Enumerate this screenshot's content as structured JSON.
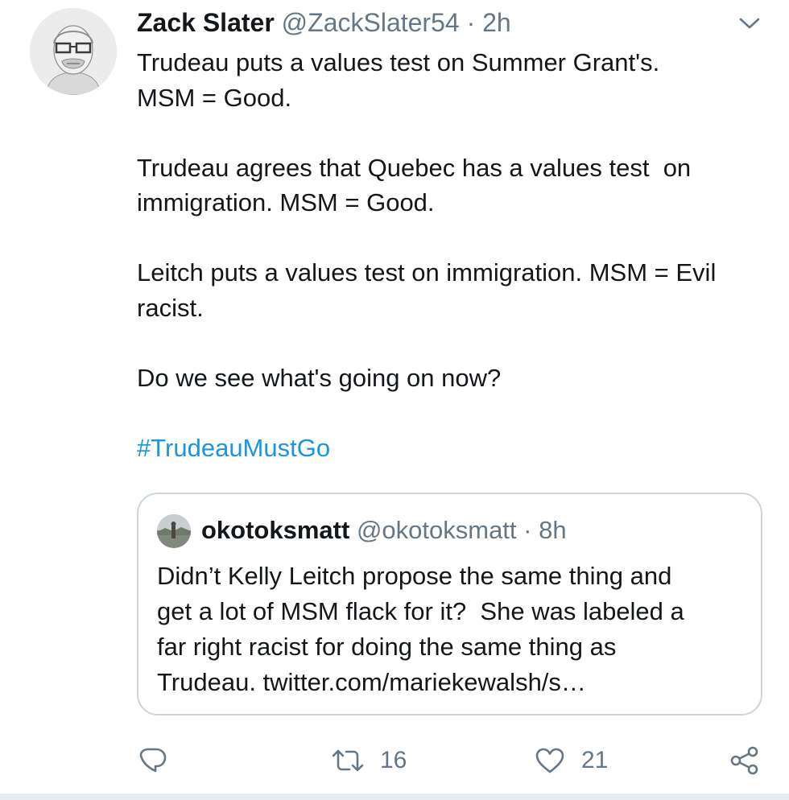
{
  "tweet": {
    "author_name": "Zack Slater",
    "author_handle": "@ZackSlater54",
    "separator": "·",
    "time": "2h",
    "paragraphs": [
      [
        "Trudeau puts a values test on Summer Grant's.",
        "MSM = Good."
      ],
      [
        "Trudeau agrees that Quebec has a values test  on",
        "immigration. MSM = Good."
      ],
      [
        "Leitch puts a values test on immigration. MSM = Evil",
        "racist."
      ],
      [
        "Do we see what's going on now?"
      ]
    ],
    "hashtag": "#TrudeauMustGo"
  },
  "quoted_tweet": {
    "author_name": "okotoksmatt",
    "author_handle": "@okotoksmatt",
    "separator": "·",
    "time": "8h",
    "lines": [
      "Didn’t Kelly Leitch propose the same thing and",
      "get a lot of MSM flack for it?  She was labeled a",
      "far right racist for doing the same thing as",
      "Trudeau. twitter.com/mariekewalsh/s…"
    ]
  },
  "actions": {
    "reply_icon": "reply-icon",
    "retweet_icon": "retweet-icon",
    "retweet_count": "16",
    "like_icon": "heart-icon",
    "like_count": "21",
    "share_icon": "share-icon"
  },
  "colors": {
    "text": "#14171a",
    "secondary": "#657786",
    "link": "#1b95e0",
    "border": "#ccd6dd"
  }
}
